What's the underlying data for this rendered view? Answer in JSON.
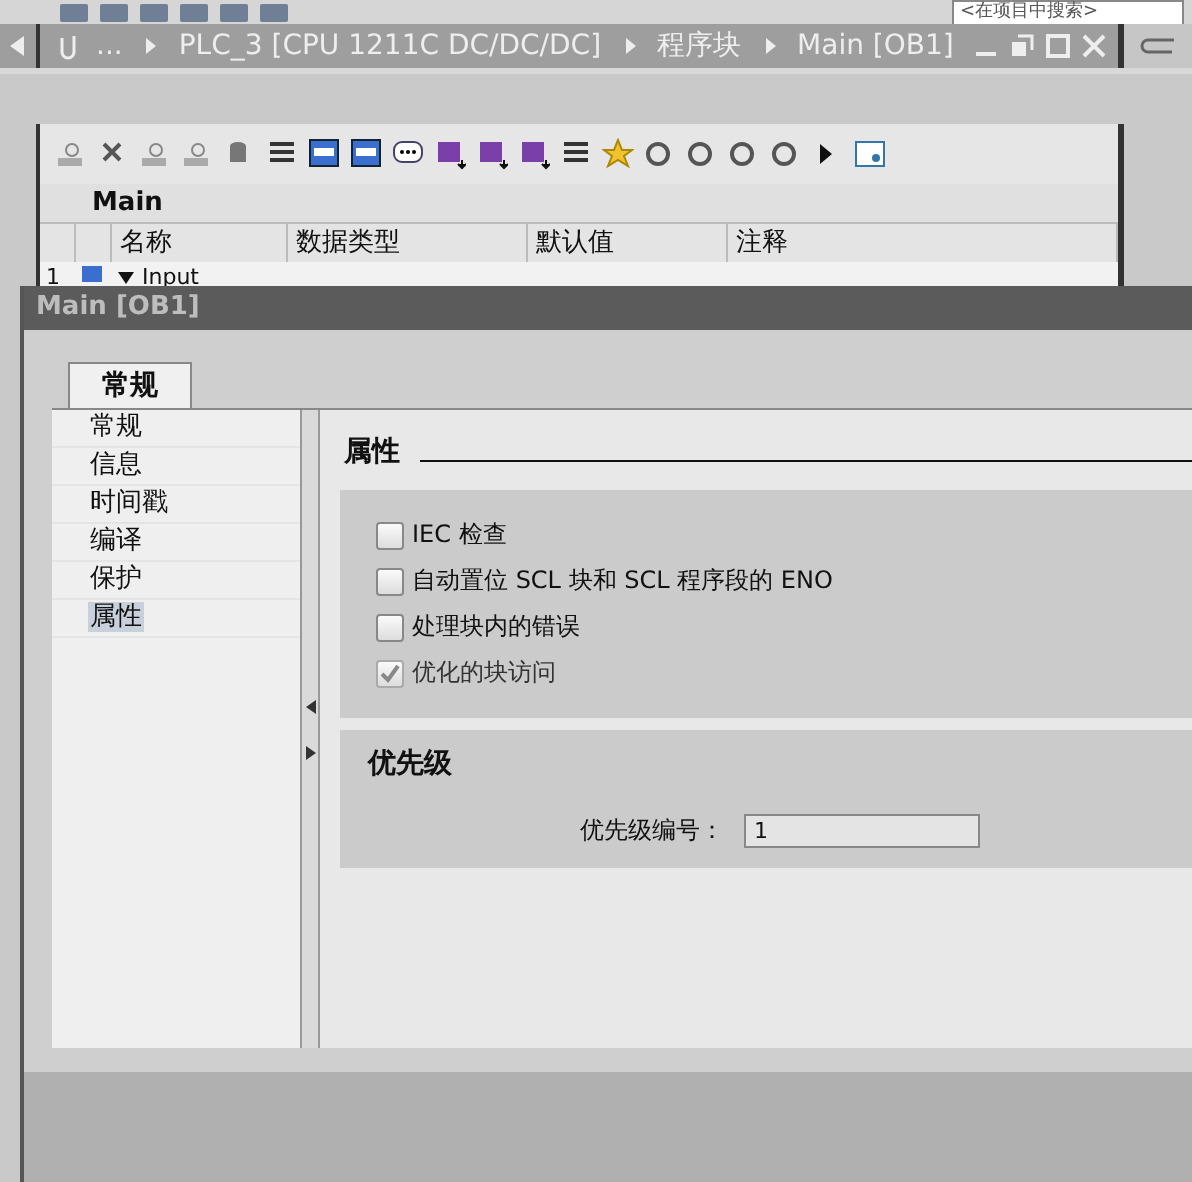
{
  "top_toolbar": {
    "search": {
      "placeholder": "<在项目中搜索>"
    }
  },
  "breadcrumb": [
    {
      "label": "..."
    },
    {
      "label": "PLC_3 [CPU 1211C DC/DC/DC]"
    },
    {
      "label": "程序块"
    },
    {
      "label": "Main [OB1]"
    }
  ],
  "editor": {
    "block_name": "Main",
    "table": {
      "columns": [
        "名称",
        "数据类型",
        "默认值",
        "注释"
      ],
      "rows": [
        {
          "number": "1",
          "name": "Input",
          "expanded": true
        }
      ]
    }
  },
  "dialog": {
    "title": "Main [OB1]",
    "tabs": [
      {
        "label": "常规",
        "selected": true
      }
    ],
    "nav": [
      {
        "label": "常规",
        "selected": false
      },
      {
        "label": "信息",
        "selected": false
      },
      {
        "label": "时间戳",
        "selected": false
      },
      {
        "label": "编译",
        "selected": false
      },
      {
        "label": "保护",
        "selected": false
      },
      {
        "label": "属性",
        "selected": true
      }
    ],
    "section_title": "属性",
    "options": [
      {
        "label": "IEC 检查",
        "checked": false,
        "disabled": false
      },
      {
        "label": "自动置位 SCL 块和 SCL 程序段的 ENO",
        "checked": false,
        "disabled": false
      },
      {
        "label": "处理块内的错误",
        "checked": false,
        "disabled": false
      },
      {
        "label": "优化的块访问",
        "checked": true,
        "disabled": true
      }
    ],
    "priority": {
      "title": "优先级",
      "label": "优先级编号：",
      "value": "1"
    }
  }
}
